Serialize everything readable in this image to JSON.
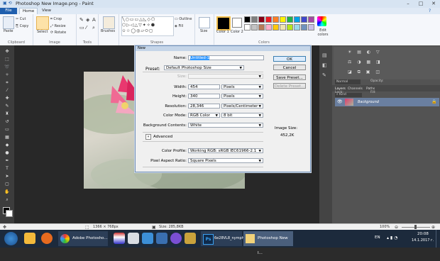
{
  "window": {
    "title": "Photoshop New Image.png - Paint"
  },
  "ribbon": {
    "tabs": {
      "file": "File",
      "home": "Home",
      "view": "View"
    },
    "clipboard": {
      "paste": "Paste",
      "cut": "Cut",
      "copy": "Copy",
      "label": "Clipboard"
    },
    "image": {
      "select": "Select",
      "crop": "Crop",
      "resize": "Resize",
      "rotate": "Rotate",
      "label": "Image"
    },
    "tools": {
      "label": "Tools"
    },
    "brushes": "Brushes",
    "shapes": {
      "outline": "Outline",
      "fill": "Fill",
      "label": "Shapes"
    },
    "size": "Size",
    "color1": "Color 1",
    "color2": "Color 2",
    "colors_label": "Colors",
    "edit_colors": "Edit colors",
    "palette": [
      "#000000",
      "#7f7f7f",
      "#880015",
      "#ed1c24",
      "#ff7f27",
      "#fff200",
      "#22b14c",
      "#00a2e8",
      "#3f48cc",
      "#a349a4",
      "#ffffff",
      "#c3c3c3",
      "#b97a57",
      "#ffaec9",
      "#ffc90e",
      "#efe4b0",
      "#b5e61d",
      "#99d9ea",
      "#7092be",
      "#c8bfe7"
    ]
  },
  "dialog": {
    "title": "New",
    "name_label": "Name:",
    "name_value": "Untitled-1",
    "preset_label": "Preset:",
    "preset_value": "Default Photoshop Size",
    "size_label": "Size:",
    "width_label": "Width:",
    "width_value": "454",
    "width_unit": "Pixels",
    "height_label": "Height:",
    "height_value": "340",
    "height_unit": "Pixels",
    "resolution_label": "Resolution:",
    "resolution_value": "28,346",
    "resolution_unit": "Pixels/Centimeter",
    "colormode_label": "Color Mode:",
    "colormode_value": "RGB Color",
    "bitdepth_value": "8 bit",
    "background_label": "Background Contents:",
    "background_value": "White",
    "advanced_label": "Advanced",
    "colorprofile_label": "Color Profile:",
    "colorprofile_value": "Working RGB:  sRGB IEC61966-2.1",
    "aspect_label": "Pixel Aspect Ratio:",
    "aspect_value": "Square Pixels",
    "ok": "OK",
    "cancel": "Cancel",
    "save_preset": "Save Preset...",
    "delete_preset": "Delete Preset...",
    "image_size_label": "Image Size:",
    "image_size_value": "452,2K"
  },
  "layers": {
    "tabs": [
      "Layers",
      "Channels",
      "Paths"
    ],
    "kind": "Kind",
    "blend": "Normal",
    "opacity": "Opacity:",
    "lock": "Lock:",
    "fill": "Fill:",
    "layer_name": "Background"
  },
  "status": {
    "dimensions": "1366 × 768px",
    "filesize": "Size: 285,8KB",
    "zoom": "100%"
  },
  "taskbar": {
    "photoshop_label": "Adobe Photosho...",
    "ps_doc": "6e28VL8_nymph...",
    "paint_label": "Photoshop New I...",
    "lang": "EN",
    "time": "20:08",
    "date": "14.1.2017 г."
  }
}
